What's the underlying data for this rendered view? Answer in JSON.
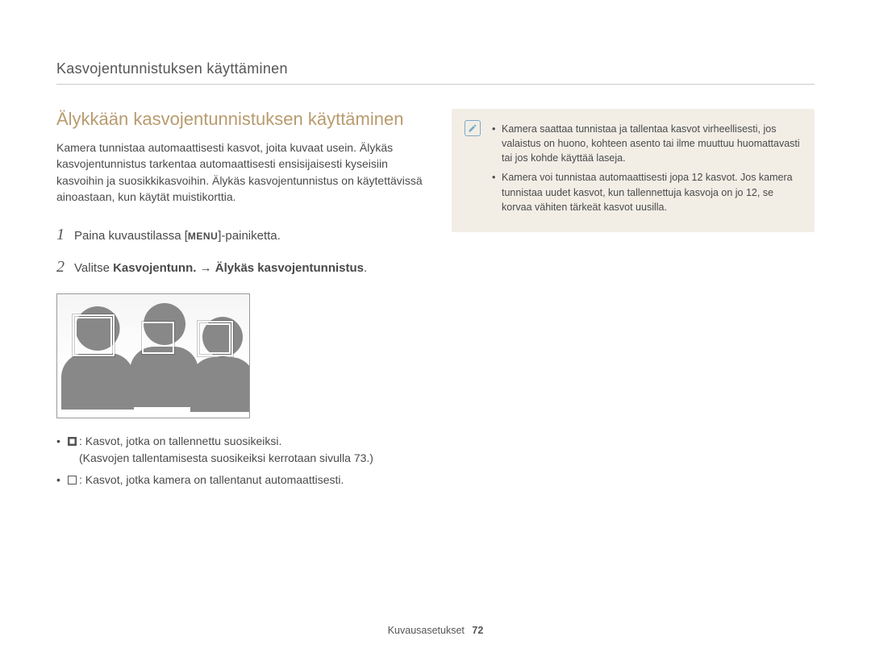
{
  "header": {
    "section": "Kasvojentunnistuksen käyttäminen"
  },
  "heading": "Älykkään kasvojentunnistuksen käyttäminen",
  "intro": "Kamera tunnistaa automaattisesti kasvot, joita kuvaat usein. Älykäs kasvojentunnistus tarkentaa automaattisesti ensisijaisesti kyseisiin kasvoihin ja suosikkikasvoihin. Älykäs kasvojentunnistus on käytettävissä ainoastaan, kun käytät muistikorttia.",
  "steps": [
    {
      "num": "1",
      "pre": "Paina kuvaustilassa [",
      "menu": "MENU",
      "post": "]-painiketta."
    },
    {
      "num": "2",
      "pre": "Valitse ",
      "bold": "Kasvojentunn. → Älykäs kasvojentunnistus",
      "post": "."
    }
  ],
  "notes": {
    "n1_main": ": Kasvot, jotka on tallennettu suosikeiksi.",
    "n1_sub": "Kasvojen tallentamisesta suosikeiksi kerrotaan sivulla 73.)",
    "n1_sub_pre": "(",
    "n2": ": Kasvot, jotka kamera on tallentanut automaattisesti."
  },
  "info": {
    "icon_name": "note-pencil-icon",
    "items": [
      "Kamera saattaa tunnistaa ja tallentaa kasvot virheellisesti, jos valaistus on huono, kohteen asento tai ilme muuttuu huomattavasti tai jos kohde käyttää laseja.",
      "Kamera voi tunnistaa automaattisesti jopa 12 kasvot. Jos kamera tunnistaa uudet kasvot, kun tallennettuja kasvoja on jo 12, se korvaa vähiten tärkeät kasvot uusilla."
    ]
  },
  "footer": {
    "label": "Kuvausasetukset",
    "page": "72"
  }
}
